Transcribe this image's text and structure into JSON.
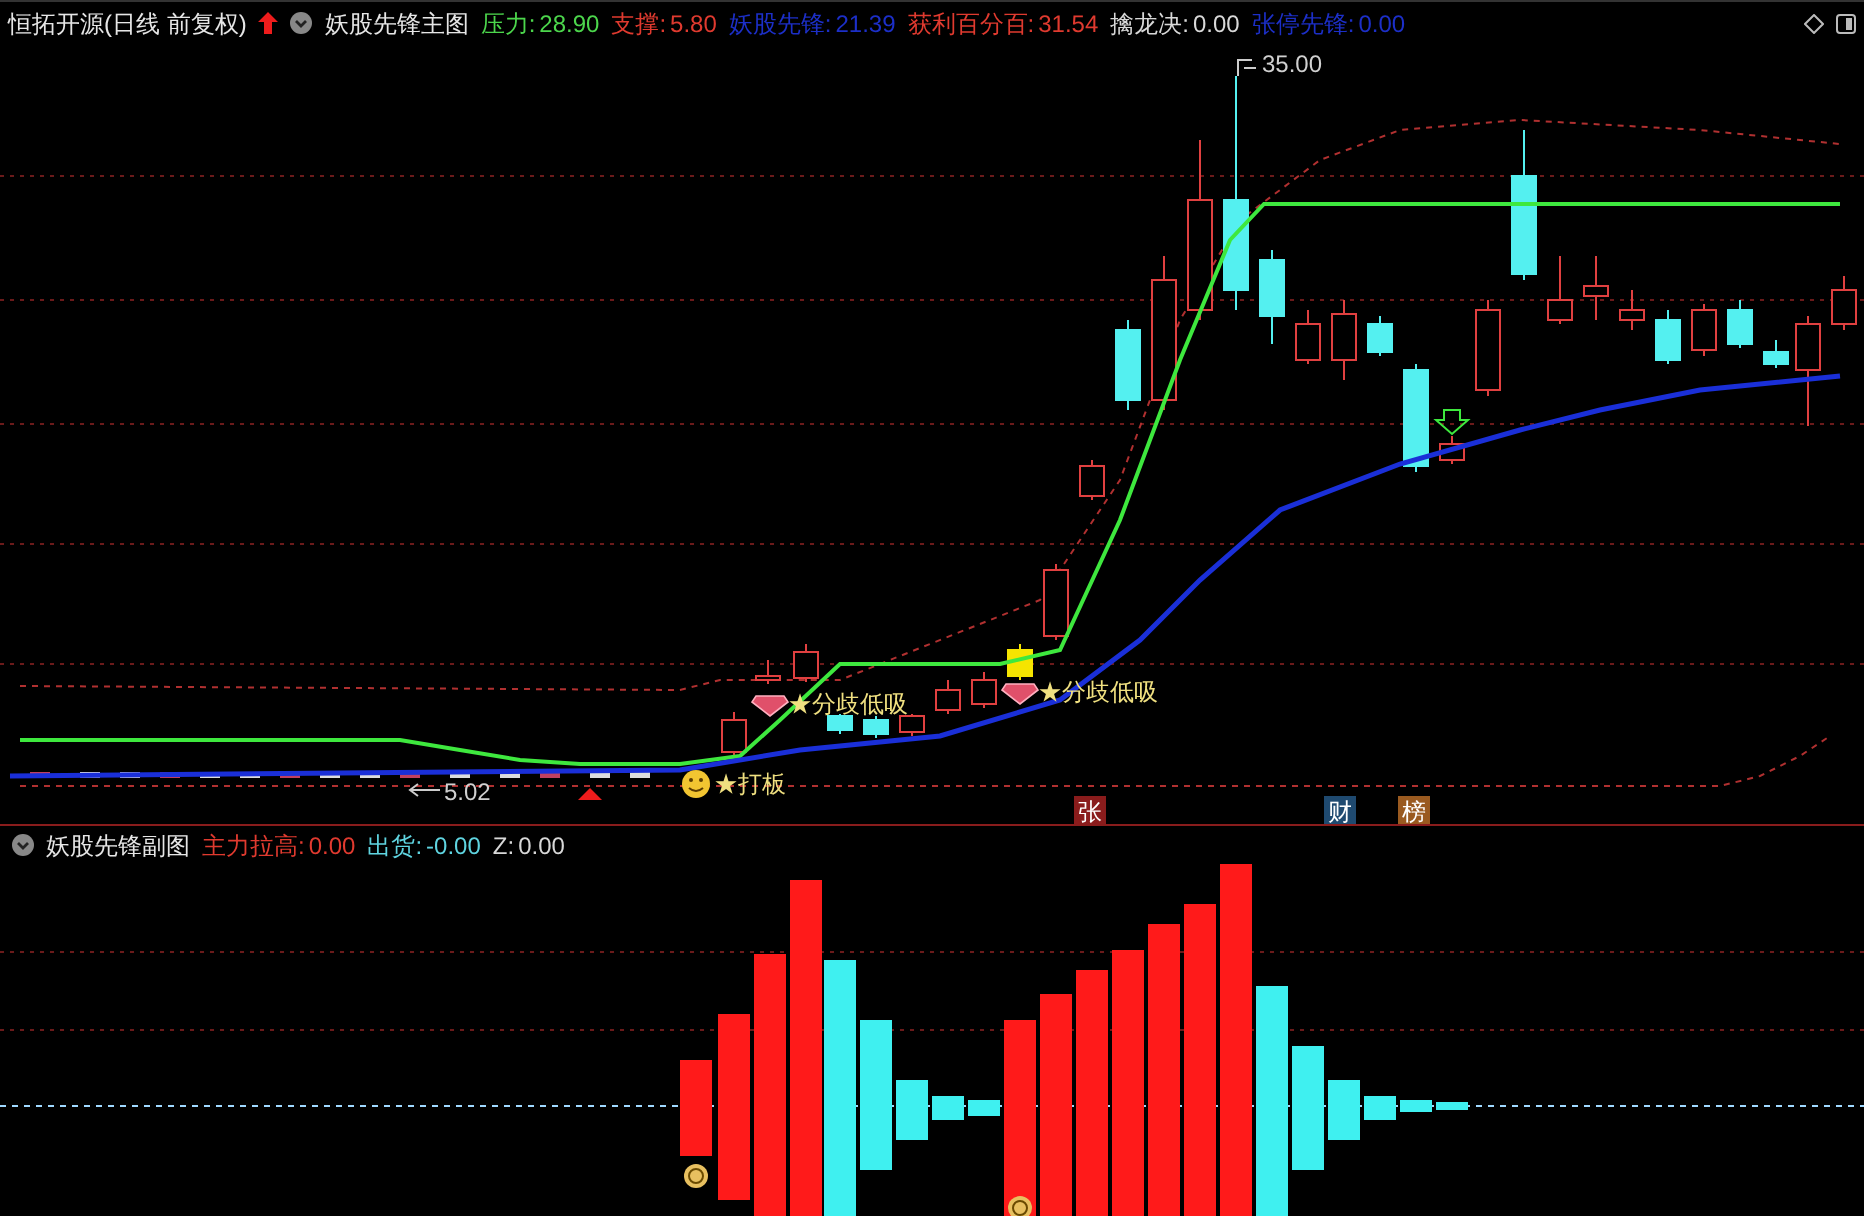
{
  "header": {
    "instrument": "恒拓开源(日线 前复权)",
    "indicator": "妖股先锋主图",
    "values": [
      {
        "label": "压力:",
        "value": "28.90",
        "color": "#4cd64c"
      },
      {
        "label": "支撑:",
        "value": "5.80",
        "color": "#e03a2f"
      },
      {
        "label": "妖股先锋:",
        "value": "21.39",
        "color": "#1c2fc8"
      },
      {
        "label": "获利百分百:",
        "value": "31.54",
        "color": "#e03a2f"
      },
      {
        "label": "擒龙决:",
        "value": "0.00",
        "color": "#d8d8d8"
      },
      {
        "label": "张停先锋:",
        "value": "0.00",
        "color": "#1c2fc8"
      }
    ]
  },
  "main_chart": {
    "high_label": "35.00",
    "low_label": "5.02",
    "signals": [
      {
        "kind": "gem",
        "text": "★分歧低吸"
      },
      {
        "kind": "gem",
        "text": "★分歧低吸"
      },
      {
        "kind": "smiley",
        "text": "★打板"
      }
    ],
    "tags": [
      {
        "text": "张",
        "color": "#8a1c1c"
      },
      {
        "text": "财",
        "color": "#1f4a70"
      },
      {
        "text": "榜",
        "color": "#9a5a20"
      }
    ]
  },
  "sub_chart": {
    "title": "妖股先锋副图",
    "values": [
      {
        "label": "主力拉高:",
        "value": "0.00",
        "color": "#e03a2f"
      },
      {
        "label": "出货:",
        "value": "-0.00",
        "color": "#5fd4e0"
      },
      {
        "label": "Z:",
        "value": "0.00",
        "color": "#d8d8d8"
      }
    ]
  }
}
